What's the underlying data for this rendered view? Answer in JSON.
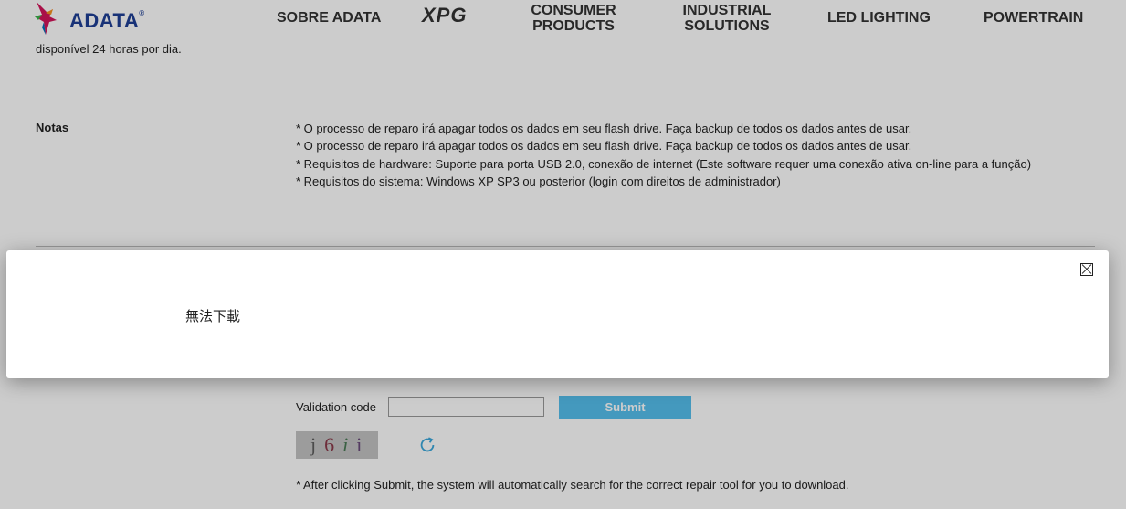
{
  "header": {
    "logo_text": "ADATA",
    "logo_reg": "®",
    "nav": {
      "sobre": "SOBRE ADATA",
      "xpg": "XPG",
      "consumer_line1": "CONSUMER",
      "consumer_line2": "PRODUCTS",
      "industrial_line1": "INDUSTRIAL",
      "industrial_line2": "SOLUTIONS",
      "led": "LED LIGHTING",
      "powertrain": "POWERTRAIN"
    }
  },
  "content": {
    "availability_text": "disponível 24 horas por dia.",
    "notes_label": "Notas",
    "notes": [
      "* O processo de reparo irá apagar todos os dados em seu flash drive. Faça backup de todos os dados antes de usar.",
      "* O processo de reparo irá apagar todos os dados em seu flash drive. Faça backup de todos os dados antes de usar.",
      "* Requisitos de hardware: Suporte para porta USB 2.0, conexão de internet (Este software requer uma conexão ativa on-line para a função)",
      "* Requisitos do sistema: Windows XP SP3 ou posterior (login com direitos de administrador)"
    ]
  },
  "form": {
    "validation_label": "Validation code",
    "validation_value": "",
    "submit_label": "Submit",
    "captcha": [
      "j",
      "6",
      "i",
      "i"
    ],
    "after_note": "* After clicking Submit, the system will automatically search for the correct repair tool for you to download."
  },
  "modal": {
    "message": "無法下載"
  },
  "colors": {
    "brand_blue": "#1f3f95",
    "submit_bg": "#55c0ee",
    "refresh_icon": "#3aa8dc",
    "overlay": "rgba(0,0,0,0.2)"
  }
}
